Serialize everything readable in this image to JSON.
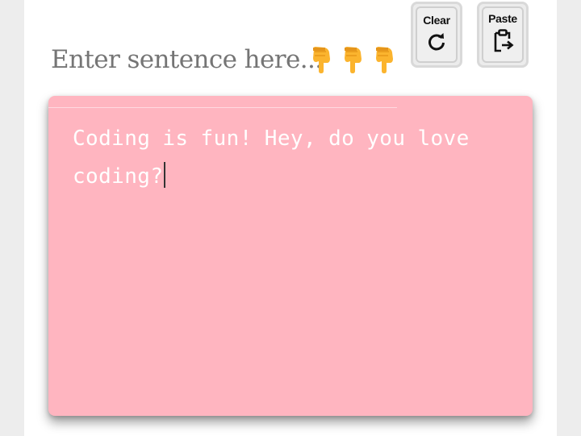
{
  "prompt": {
    "text": "Enter sentence here...",
    "hands": [
      "pointing-down-hand",
      "pointing-down-hand",
      "pointing-down-hand"
    ]
  },
  "buttons": {
    "clear_label": "Clear",
    "clear_icon": "refresh-icon",
    "paste_label": "Paste",
    "paste_icon": "clipboard-paste-icon"
  },
  "editor": {
    "value": "Coding is fun! Hey, do you love coding?",
    "background": "#ffb5c0",
    "text_color": "#ffffff"
  }
}
